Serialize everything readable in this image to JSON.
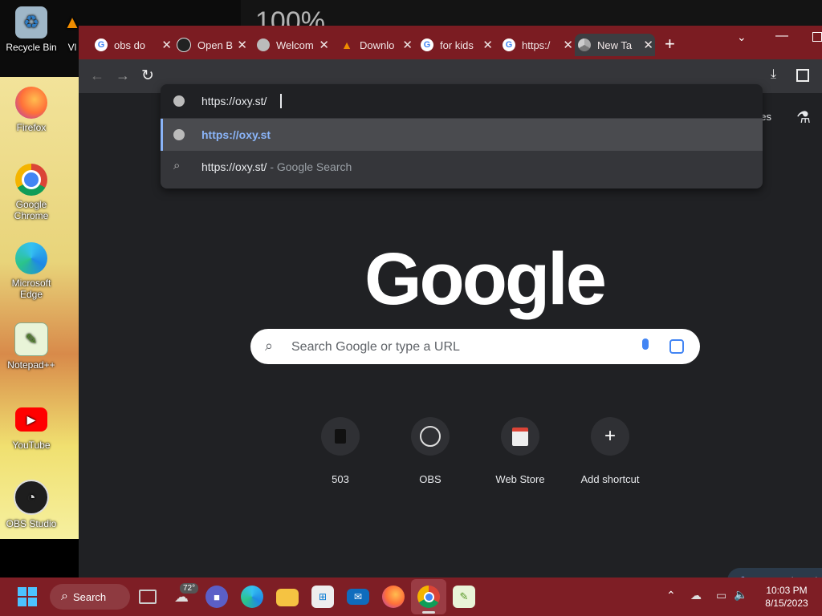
{
  "desktop": {
    "top_text": "100%",
    "icons": [
      {
        "label": "Recycle Bin"
      },
      {
        "label": "Vl"
      },
      {
        "label": "Firefox"
      },
      {
        "label": "Google Chrome"
      },
      {
        "label": "Microsoft Edge"
      },
      {
        "label": "Notepad++"
      },
      {
        "label": "YouTube"
      },
      {
        "label": "OBS Studio"
      }
    ]
  },
  "tabs": [
    {
      "title": "obs do",
      "icon": "google-icon"
    },
    {
      "title": "Open B",
      "icon": "obs-icon"
    },
    {
      "title": "Welcom",
      "icon": "globe-icon"
    },
    {
      "title": "Downlo",
      "icon": "vlc-icon"
    },
    {
      "title": "for kids",
      "icon": "google-icon"
    },
    {
      "title": "https:/",
      "icon": "google-icon"
    },
    {
      "title": "New Ta",
      "icon": "chrome-icon",
      "active": true
    }
  ],
  "omnibox": {
    "value": "https://oxy.st/",
    "suggestions": [
      {
        "text": "https://oxy.st",
        "suffix": ""
      },
      {
        "text": "https://oxy.st/",
        "suffix": "- Google Search"
      }
    ]
  },
  "header_links": {
    "images": "ges"
  },
  "newtab": {
    "logo": "Google",
    "search_placeholder": "Search Google or type a URL",
    "shortcuts": [
      {
        "label": "503"
      },
      {
        "label": "OBS"
      },
      {
        "label": "Web Store"
      },
      {
        "label": "Add shortcut"
      }
    ],
    "customize_label": "Customize Ch"
  },
  "taskbar": {
    "search_label": "Search",
    "weather_temp": "72°",
    "time": "10:03 PM",
    "date": "8/15/2023"
  },
  "colors": {
    "titlebar": "#7b1c22",
    "taskbar": "#7e1e25",
    "link": "#8ab4f8"
  }
}
